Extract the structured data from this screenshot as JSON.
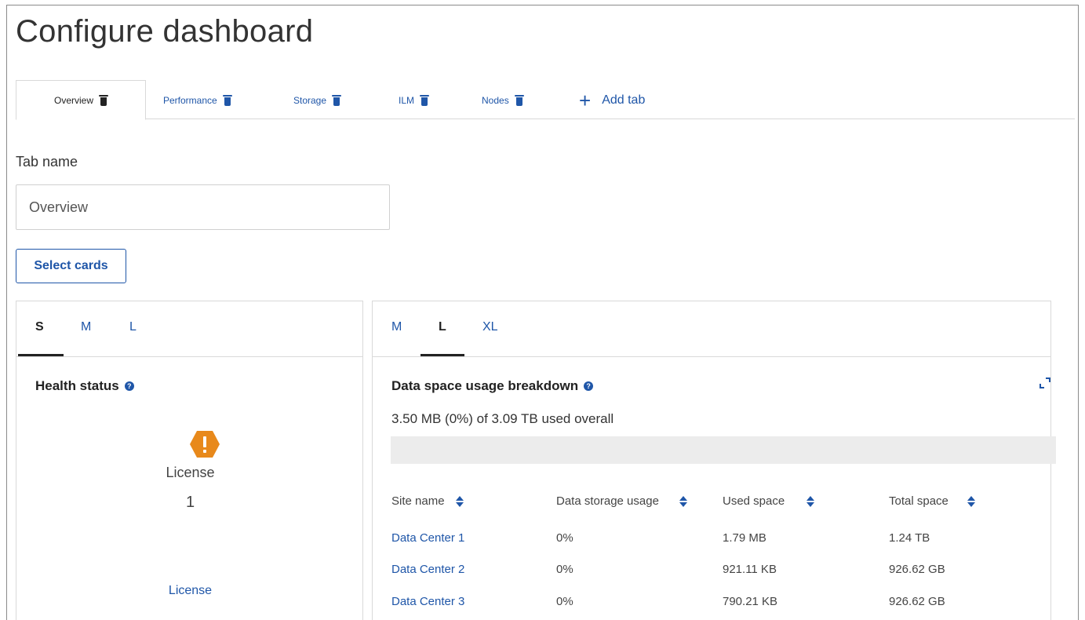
{
  "page": {
    "title": "Configure dashboard"
  },
  "tabs": [
    {
      "label": "Overview",
      "active": true
    },
    {
      "label": "Performance",
      "active": false
    },
    {
      "label": "Storage",
      "active": false
    },
    {
      "label": "ILM",
      "active": false
    },
    {
      "label": "Nodes",
      "active": false
    }
  ],
  "add_tab_label": "Add tab",
  "tab_name": {
    "label": "Tab name",
    "value": "Overview"
  },
  "select_cards_label": "Select cards",
  "left_card": {
    "sizes": [
      "S",
      "M",
      "L"
    ],
    "active_size": "S",
    "title": "Health status",
    "item_label": "License",
    "item_count": "1",
    "link_label": "License"
  },
  "right_card": {
    "sizes": [
      "M",
      "L",
      "XL"
    ],
    "active_size": "L",
    "title": "Data space usage breakdown",
    "summary": "3.50 MB (0%) of 3.09 TB used overall",
    "usage_fraction": 0.0,
    "columns": [
      "Site name",
      "Data storage usage",
      "Used space",
      "Total space"
    ],
    "rows": [
      [
        "Data Center 1",
        "0%",
        "1.79 MB",
        "1.24 TB"
      ],
      [
        "Data Center 2",
        "0%",
        "921.11 KB",
        "926.62 GB"
      ],
      [
        "Data Center 3",
        "0%",
        "790.21 KB",
        "926.62 GB"
      ]
    ]
  },
  "colors": {
    "link": "#1f56a8",
    "warning": "#e8891b",
    "border": "#d9d9d9"
  }
}
